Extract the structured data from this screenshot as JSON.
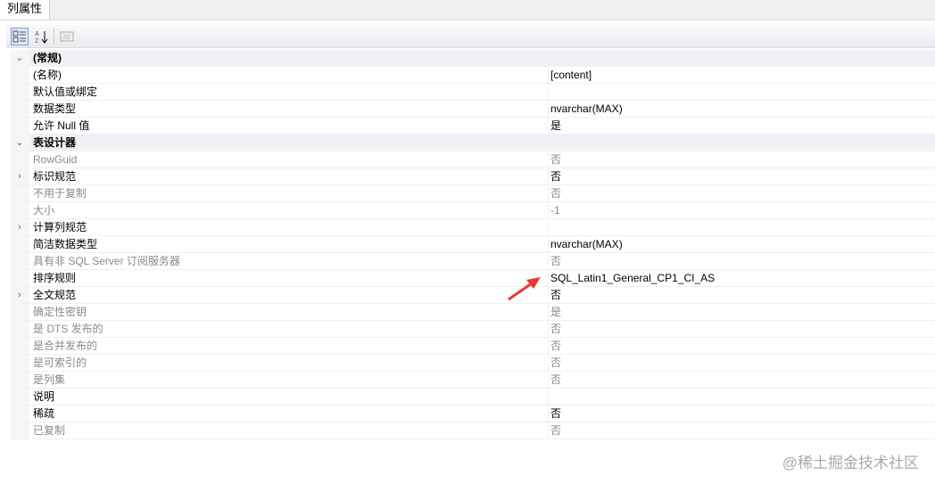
{
  "tab": "列属性",
  "toolbar": {
    "categorized": "categorized-icon",
    "alphabetical": "sort-az-icon",
    "pages": "property-pages-icon"
  },
  "rows": [
    {
      "name": "(常规)",
      "value": "",
      "type": "category",
      "expand": "⌄"
    },
    {
      "name": "(名称)",
      "value": "[content]",
      "type": "normal",
      "expand": ""
    },
    {
      "name": "默认值或绑定",
      "value": "",
      "type": "normal",
      "expand": ""
    },
    {
      "name": "数据类型",
      "value": "nvarchar(MAX)",
      "type": "normal",
      "expand": ""
    },
    {
      "name": "允许 Null 值",
      "value": "是",
      "type": "normal",
      "expand": ""
    },
    {
      "name": "表设计器",
      "value": "",
      "type": "category",
      "expand": "⌄"
    },
    {
      "name": "RowGuid",
      "value": "否",
      "type": "gray",
      "expand": ""
    },
    {
      "name": "标识规范",
      "value": "否",
      "type": "normal",
      "expand": "›"
    },
    {
      "name": "不用于复制",
      "value": "否",
      "type": "gray",
      "expand": ""
    },
    {
      "name": "大小",
      "value": "-1",
      "type": "gray",
      "expand": ""
    },
    {
      "name": "计算列规范",
      "value": "",
      "type": "normal",
      "expand": "›"
    },
    {
      "name": "简洁数据类型",
      "value": "nvarchar(MAX)",
      "type": "normal",
      "expand": ""
    },
    {
      "name": "具有非 SQL Server 订阅服务器",
      "value": "否",
      "type": "gray",
      "expand": ""
    },
    {
      "name": "排序规则",
      "value": "SQL_Latin1_General_CP1_CI_AS",
      "type": "normal",
      "expand": ""
    },
    {
      "name": "全文规范",
      "value": "否",
      "type": "normal",
      "expand": "›"
    },
    {
      "name": "确定性密钥",
      "value": "是",
      "type": "gray",
      "expand": ""
    },
    {
      "name": "是 DTS 发布的",
      "value": "否",
      "type": "gray",
      "expand": ""
    },
    {
      "name": "是合并发布的",
      "value": "否",
      "type": "gray",
      "expand": ""
    },
    {
      "name": "是可索引的",
      "value": "否",
      "type": "gray",
      "expand": ""
    },
    {
      "name": "是列集",
      "value": "否",
      "type": "gray",
      "expand": ""
    },
    {
      "name": "说明",
      "value": "",
      "type": "normal",
      "expand": ""
    },
    {
      "name": "稀疏",
      "value": "否",
      "type": "normal",
      "expand": ""
    },
    {
      "name": "已复制",
      "value": "否",
      "type": "gray",
      "expand": ""
    }
  ],
  "watermark": "@稀土掘金技术社区",
  "colors": {
    "arrow": "#e53935"
  }
}
